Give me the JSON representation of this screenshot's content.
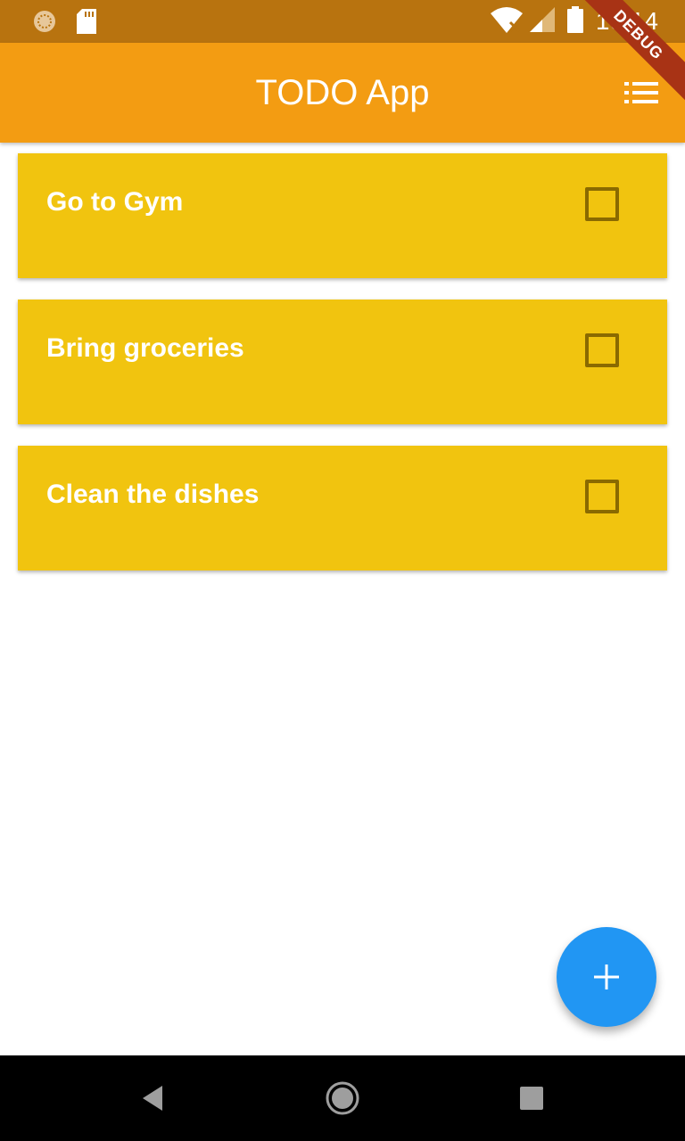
{
  "status_bar": {
    "time": "10:14",
    "icons": [
      "sync-icon",
      "sd-card-icon",
      "wifi-off-icon",
      "signal-icon",
      "battery-icon"
    ]
  },
  "app_bar": {
    "title": "TODO App",
    "menu_icon": "list-icon"
  },
  "debug_banner": "DEBUG",
  "todos": [
    {
      "title": "Go to Gym",
      "checked": false
    },
    {
      "title": "Bring groceries",
      "checked": false
    },
    {
      "title": "Clean the dishes",
      "checked": false
    }
  ],
  "fab": {
    "icon": "plus-icon"
  },
  "colors": {
    "status_bar": "#b8730f",
    "app_bar": "#f39c12",
    "card": "#f1c40f",
    "fab": "#2196f3",
    "debug": "#a83315"
  },
  "nav": {
    "icons": [
      "back-icon",
      "home-icon",
      "recents-icon"
    ]
  }
}
